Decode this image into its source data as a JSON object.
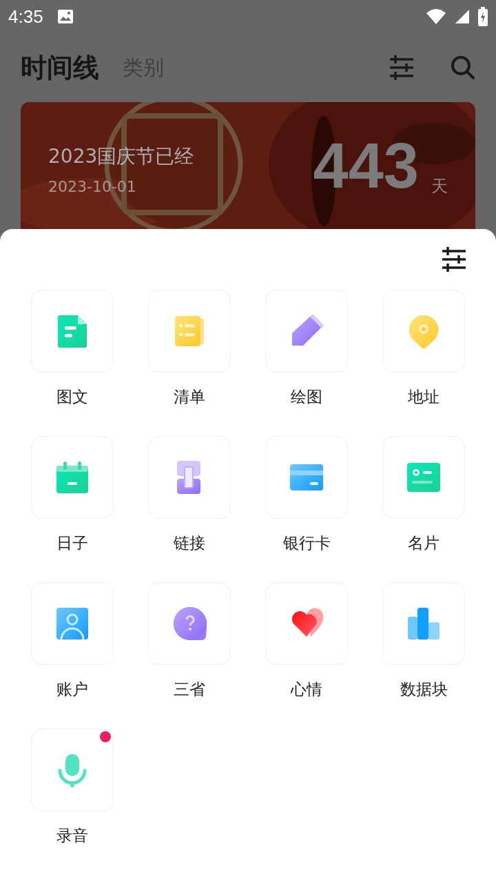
{
  "status_bar": {
    "time": "4:35"
  },
  "header": {
    "tabs": [
      {
        "label": "时间线",
        "selected": true
      },
      {
        "label": "类别",
        "selected": false
      }
    ]
  },
  "banner": {
    "title": "2023国庆节已经",
    "date": "2023-10-01",
    "count": "443",
    "unit": "天"
  },
  "sheet": {
    "items": [
      {
        "label": "图文",
        "kind": "document",
        "badge": false
      },
      {
        "label": "清单",
        "kind": "list",
        "badge": false
      },
      {
        "label": "绘图",
        "kind": "pencil",
        "badge": false
      },
      {
        "label": "地址",
        "kind": "pin",
        "badge": false
      },
      {
        "label": "日子",
        "kind": "calendar",
        "badge": false
      },
      {
        "label": "链接",
        "kind": "link",
        "badge": false
      },
      {
        "label": "银行卡",
        "kind": "card",
        "badge": false
      },
      {
        "label": "名片",
        "kind": "contact",
        "badge": false
      },
      {
        "label": "账户",
        "kind": "account",
        "badge": false
      },
      {
        "label": "三省",
        "kind": "question",
        "badge": false
      },
      {
        "label": "心情",
        "kind": "heart",
        "badge": false
      },
      {
        "label": "数据块",
        "kind": "bars",
        "badge": false
      },
      {
        "label": "录音",
        "kind": "mic",
        "badge": true
      }
    ]
  }
}
